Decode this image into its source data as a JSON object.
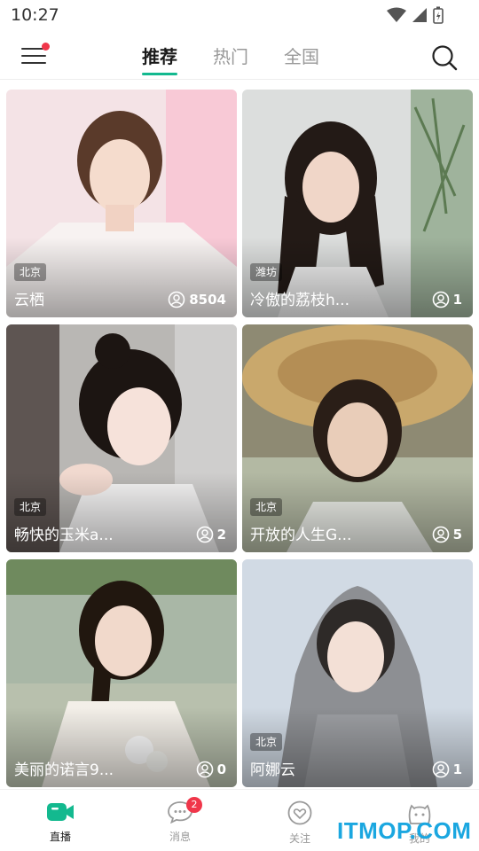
{
  "status_bar": {
    "time": "10:27"
  },
  "nav": {
    "tabs": [
      {
        "label": "推荐",
        "active": true
      },
      {
        "label": "热门",
        "active": false
      },
      {
        "label": "全国",
        "active": false
      }
    ],
    "menu_has_notification": true
  },
  "cards": [
    {
      "city": "北京",
      "name": "云栖",
      "viewers": "8504"
    },
    {
      "city": "潍坊",
      "name": "冷傲的荔枝h...",
      "viewers": "1"
    },
    {
      "city": "北京",
      "name": "畅快的玉米a...",
      "viewers": "2"
    },
    {
      "city": "北京",
      "name": "开放的人生G...",
      "viewers": "5"
    },
    {
      "city": "",
      "name": "美丽的诺言9...",
      "viewers": "0"
    },
    {
      "city": "北京",
      "name": "阿娜云",
      "viewers": "1"
    }
  ],
  "bottom_nav": {
    "items": [
      {
        "label": "直播",
        "icon": "live-camera-icon",
        "active": true
      },
      {
        "label": "消息",
        "icon": "message-icon",
        "badge": "2"
      },
      {
        "label": "关注",
        "icon": "heart-icon"
      },
      {
        "label": "我的",
        "icon": "profile-icon"
      }
    ]
  },
  "watermark": "ITMOP.COM",
  "colors": {
    "accent": "#13b98f",
    "badge": "#f0364a",
    "watermark": "#1ba7e0"
  }
}
